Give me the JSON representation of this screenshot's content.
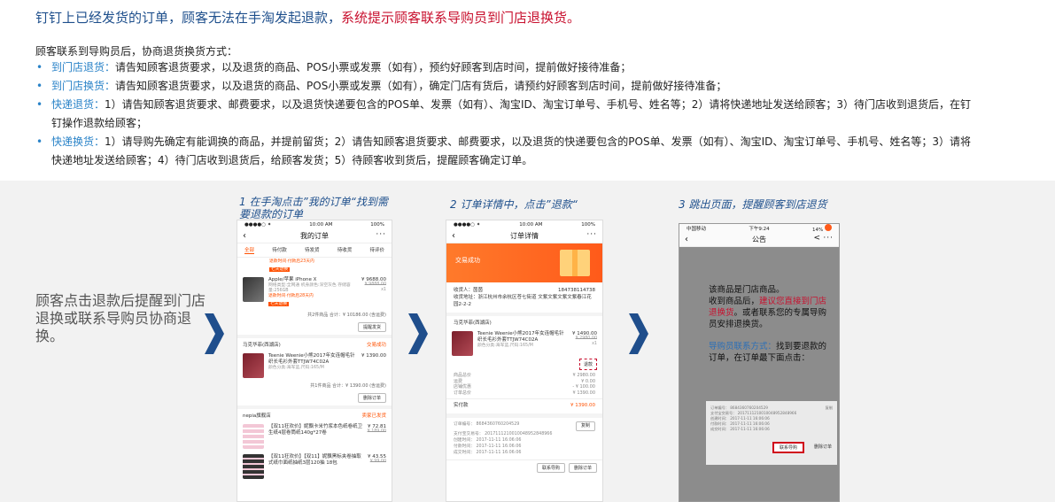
{
  "heading": {
    "main": "钉钉上已经发货的订单，顾客无法在手淘发起退款，",
    "red": "系统提示顾客联系导购员到门店退换货。"
  },
  "intro": "顾客联系到导购员后，协商退货换货方式：",
  "bullets": [
    {
      "label": "到门店退货：",
      "text": "请告知顾客退货要求，以及退货的商品、POS小票或发票（如有），预约好顾客到店时间，提前做好接待准备；"
    },
    {
      "label": "到门店换货：",
      "text": "请告知顾客退货要求，以及退货的商品、POS小票或发票（如有），确定门店有货后，请预约好顾客到店时间，提前做好接待准备；"
    },
    {
      "label": "快递退货：",
      "text": "1）请告知顾客退货要求、邮费要求，以及退货快递要包含的POS单、发票（如有）、淘宝ID、淘宝订单号、手机号、姓名等；2）请将快递地址发送给顾客；3）待门店收到退货后，在钉钉操作退款给顾客；"
    },
    {
      "label": "快递换货：",
      "text": "1）请导购先确定有能调换的商品，并提前留货；2）请告知顾客退货要求、邮费要求，以及退货的快递要包含的POS单、发票（如有）、淘宝ID、淘宝订单号、手机号、姓名等；3）请将快递地址发送给顾客；4）待门店收到退货后，给顾客发货；5）待顾客收到货后，提醒顾客确定订单。"
    }
  ],
  "left_caption": "顾客点击退款后提醒到门店退换或联系导购员协商退换。",
  "steps": [
    {
      "title": "1 在手淘点击”我的订单“找到需要退款的订单"
    },
    {
      "title": "2 订单详情中，点击”退款“"
    },
    {
      "title": "3 跳出页面，提醒顾客到店退货"
    }
  ],
  "phone1": {
    "status_time": "10:00 AM",
    "battery": "100%",
    "title": "我的订单",
    "tabs": [
      "全部",
      "待付款",
      "待发货",
      "待收货",
      "待评价"
    ],
    "note1": "退款时间·付款后23天内",
    "badge": "七天退换",
    "product": "Apple/苹果 iPhone X",
    "product_desc": "网络类型:全网通 机身颜色:深空灰色 存储容量:256GB",
    "price": "¥ 9688.00",
    "old_price": "¥ 9888.00",
    "qty": "x1",
    "note2": "退款时间·付款后28天内",
    "total": "共2件商品 合计：¥ 10186.00 (含运费)",
    "btn_view": "提醒发货",
    "shop2": "马克华菲(西湖店)",
    "shop2_status": "交易成功",
    "prod2": "Teenie Weenie小熊2017年女连帽毛针织长毛衫外套TTJW74C02A",
    "prod2_desc": "颜色分类:海军蓝,尺码:165/M",
    "price2": "¥ 1390.00",
    "total2": "共1件商品 合计：¥ 1390.00 (含运费)",
    "btn_delete": "删除订单",
    "shop3": "nepia旗舰店",
    "shop3_status": "卖家已发货",
    "prod3": "【双11狂欢价】妮飘卡米竹浆本色纸卷纸卫生纸4层卷筒纸140g*27卷",
    "price3": "¥ 72.81",
    "old3": "¥ 189.00",
    "prod4": "【双11狂欢价】【双11】妮飘黑标夹卷抽取式纸巾面纸抽纸3层120抽 18包",
    "price4": "¥ 43.55",
    "old4": "¥ 99.00"
  },
  "phone2": {
    "status_time": "10:00 AM",
    "battery": "100%",
    "title": "订单详情",
    "banner": "交易成功",
    "receiver": "收货人：茵茵",
    "phone": "184738114738",
    "address": "收货地址：浙江杭州市余杭区苍七街道 文紫文紫文紫文紫春江花园2-2-2",
    "shop": "马克华菲(西湖店)",
    "prod": "Teenie Weenie小熊2017年女连帽毛针织长毛衫外套TTJW74C02A",
    "prod_desc": "颜色分类:海军蓝,尺码:165/M",
    "price": "¥ 1490.00",
    "old_price": "¥ 2980.00",
    "qty": "x1",
    "refund": "退款",
    "rows": [
      {
        "k": "商品总价",
        "v": "¥ 2980.00"
      },
      {
        "k": "运费",
        "v": "¥ 0.00"
      },
      {
        "k": "店铺优惠",
        "v": "- ¥ 100.00"
      },
      {
        "k": "订单总价",
        "v": "¥ 1390.00"
      }
    ],
    "paid_label": "实付款",
    "paid": "¥ 1390.00",
    "order_no": "订单编号：  8684360760204529",
    "copy": "复制",
    "alipay": "支付宝交易号：  2017111210010048952848966",
    "created": "创建时间：  2017-11-11 16:06:06",
    "paytime": "付款时间：  2017-11-11 16:06:06",
    "done": "成交时间：  2017-11-11 16:06:06",
    "btn_contact": "联系导购",
    "btn_delete": "删除订单"
  },
  "phone3": {
    "carrier": "中国移动",
    "time": "下午9:24",
    "battery": "14%",
    "title": "公告",
    "line1": "该商品是门店商品。",
    "line2a": "收到商品后，",
    "line2b": "建议您直接到门店退换货",
    "line2c": "。或者联系您的专属导购员安排退换货。",
    "line3a": "导购员联系方式：",
    "line3b": "找到要退款的订单，在订单最下面点击：",
    "card_order": "订单编号：  8684360760204529",
    "card_copy": "复制",
    "card_alipay": "支付宝交易号：  2017111210010048952848966",
    "card_created": "创建时间：  2017-11-11 16:06:06",
    "card_pay": "付款时间：  2017-11-11 16:06:06",
    "card_done": "成交时间：  2017-11-11 16:06:06",
    "btn_contact": "联系导购",
    "btn_delete": "删除订单"
  },
  "colors": {
    "heading_blue": "#1e4f8c",
    "alert_red": "#c8102e",
    "label_blue": "#2a83c8",
    "arrow_blue": "#1f4e8c",
    "taobao_orange": "#ff5000"
  }
}
